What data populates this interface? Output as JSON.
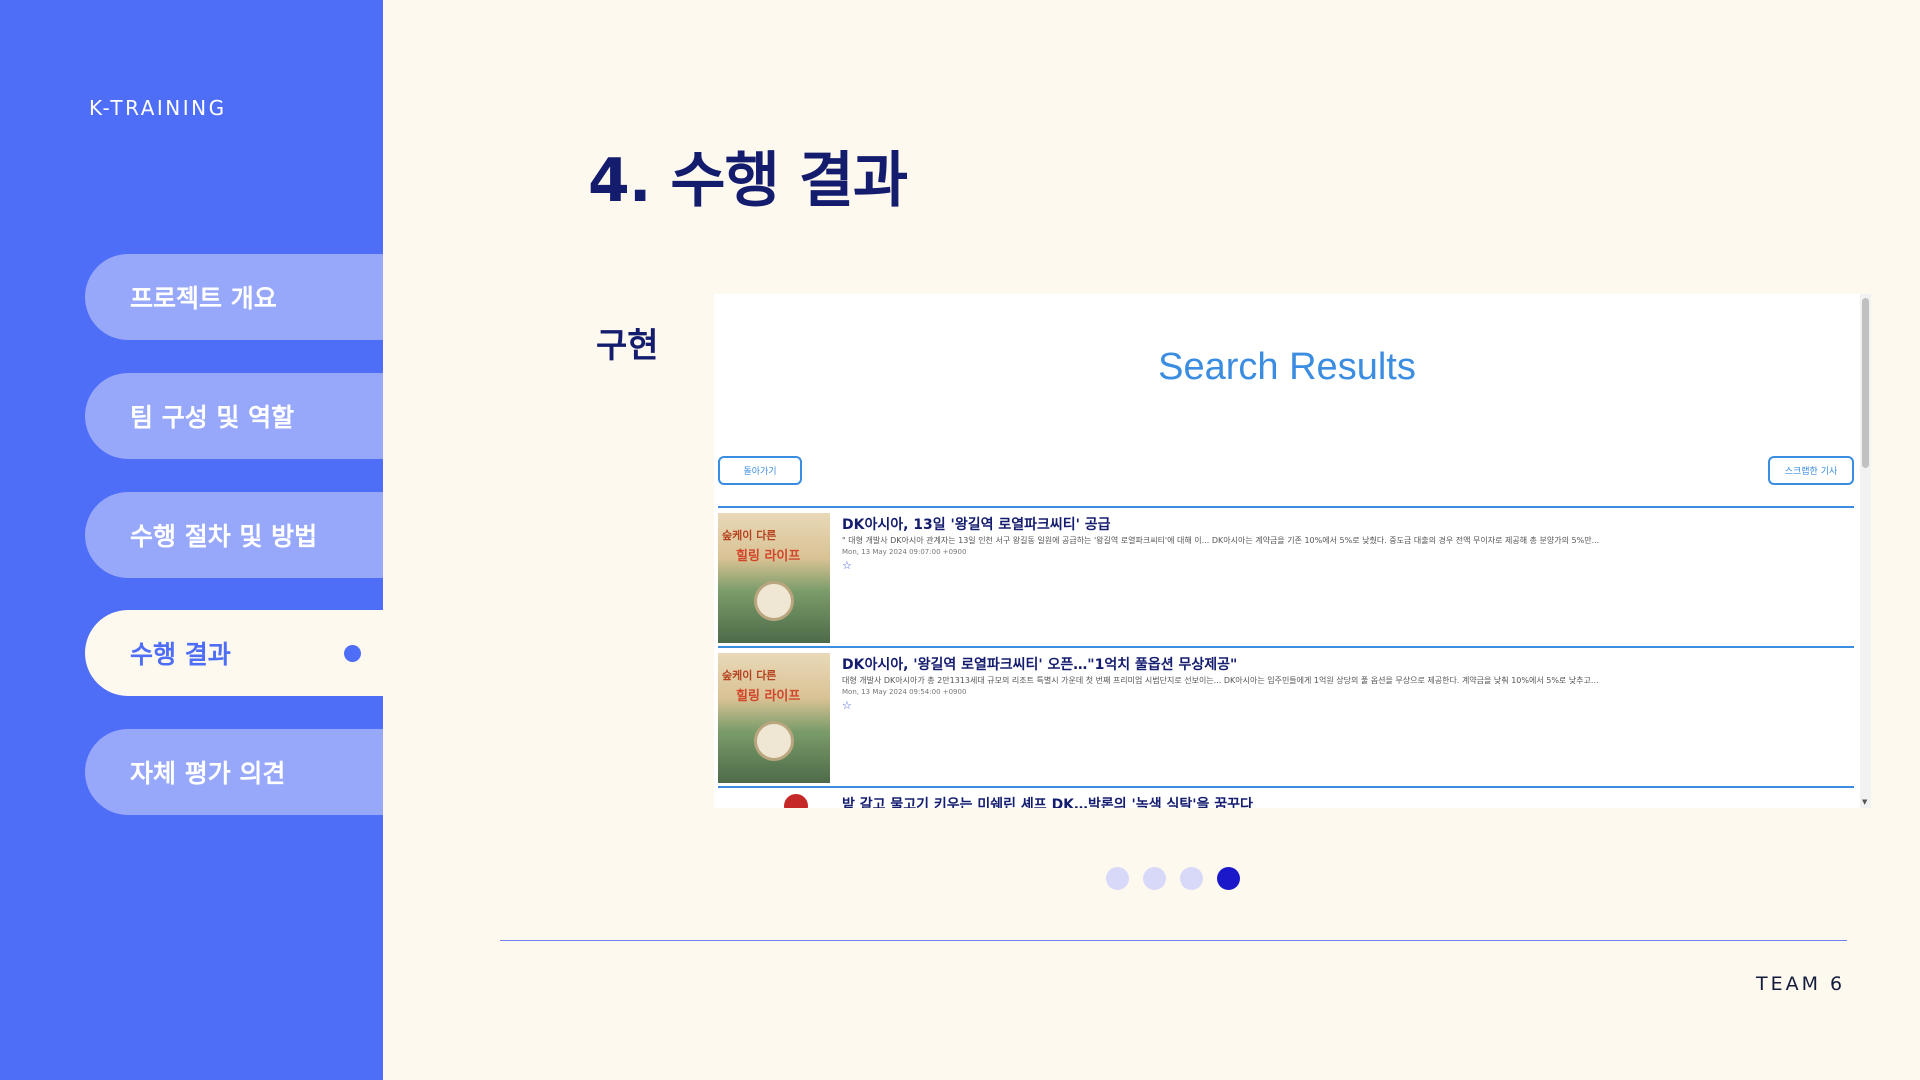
{
  "brand": "K-TRAINING",
  "nav": [
    {
      "label": "프로젝트 개요",
      "active": false
    },
    {
      "label": "팀 구성 및 역할",
      "active": false
    },
    {
      "label": "수행 절차 및 방법",
      "active": false
    },
    {
      "label": "수행 결과",
      "active": true
    },
    {
      "label": "자체 평가 의견",
      "active": false
    }
  ],
  "page_title": "4. 수행 결과",
  "section_label": "구현",
  "screenshot": {
    "heading": "Search Results",
    "back_button": "돌아가기",
    "scrap_button": "스크랩한 기사",
    "articles": [
      {
        "title": "DK아시아, 13일 '왕길역 로열파크씨티' 공급",
        "summary": "\" 대형 개발사 DK아시아 관계자는 13일 인천 서구 왕길동 일원에 공급하는 '왕길역 로열파크씨티'에 대해 이... DK아시아는 계약금을 기존 10%에서 5%로 낮췄다. 중도금 대출의 경우 전액 무이자로 제공해 총 분양가의 5%만...",
        "date": "Mon, 13 May 2024 09:07:00 +0900",
        "star": "☆",
        "thumb_line1": "숲케이 다른",
        "thumb_line2": "힐링 라이프"
      },
      {
        "title": "DK아시아, '왕길역 로열파크씨티' 오픈…\"1억치 풀옵션 무상제공\"",
        "summary": "대형 개발사 DK아시아가 총 2만1313세대 규모의 리조트 특별시 가운데 첫 번째 프리미엄 시범단지로 선보이는... DK아시아는 입주민들에게 1억원 상당의 풀 옵션을 무상으로 제공한다. 계약금을 낮춰 10%에서 5%로 낮추고...",
        "date": "Mon, 13 May 2024 09:54:00 +0900",
        "star": "☆",
        "thumb_line1": "숲케이 다른",
        "thumb_line2": "힐링 라이프"
      },
      {
        "title": "밭 갈고 물고기 키우는 미쉐린 셰프 DK…박론의 '녹색 식탁'을 꿈꾸다"
      }
    ]
  },
  "pagination": {
    "count": 4,
    "active_index": 3
  },
  "footer_team": "TEAM 6",
  "colors": {
    "sidebar": "#4f6ef7",
    "nav_inactive": "#97a8fa",
    "background": "#fdf9ef",
    "title": "#141c6e",
    "accent_blue": "#3a8de0",
    "dot_active": "#1a18c9"
  }
}
